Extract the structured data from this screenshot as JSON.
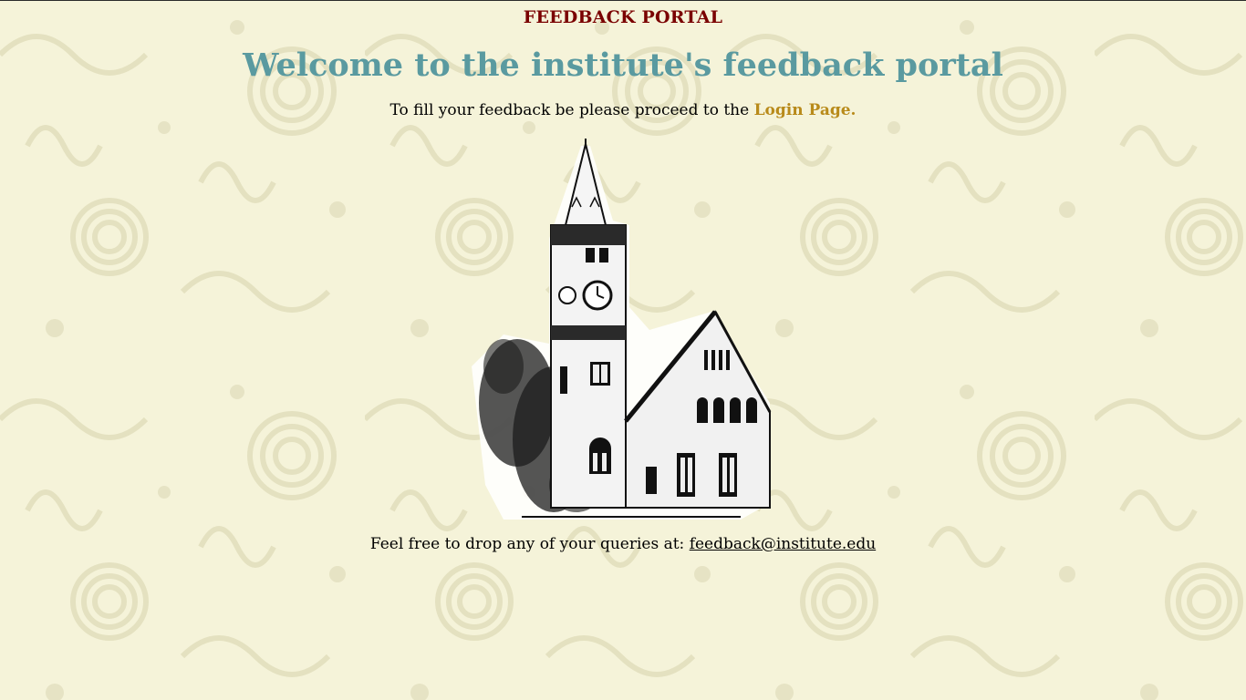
{
  "header": {
    "portal_title": "FEEDBACK PORTAL"
  },
  "main": {
    "welcome_heading": "Welcome to the institute's feedback portal",
    "intro_text": "To fill your feedback be please proceed to the ",
    "login_link_label": "Login Page.",
    "illustration_icon": "clock-tower-building-illustration",
    "query_text": "Feel free to drop any of your queries at: ",
    "email_link_label": "feedback@institute.edu"
  },
  "colors": {
    "background": "#f5f3d9",
    "portal_title": "#7a0000",
    "welcome_heading": "#5a9aa0",
    "login_link": "#b88a1a",
    "pattern": "#e6e3c4"
  }
}
